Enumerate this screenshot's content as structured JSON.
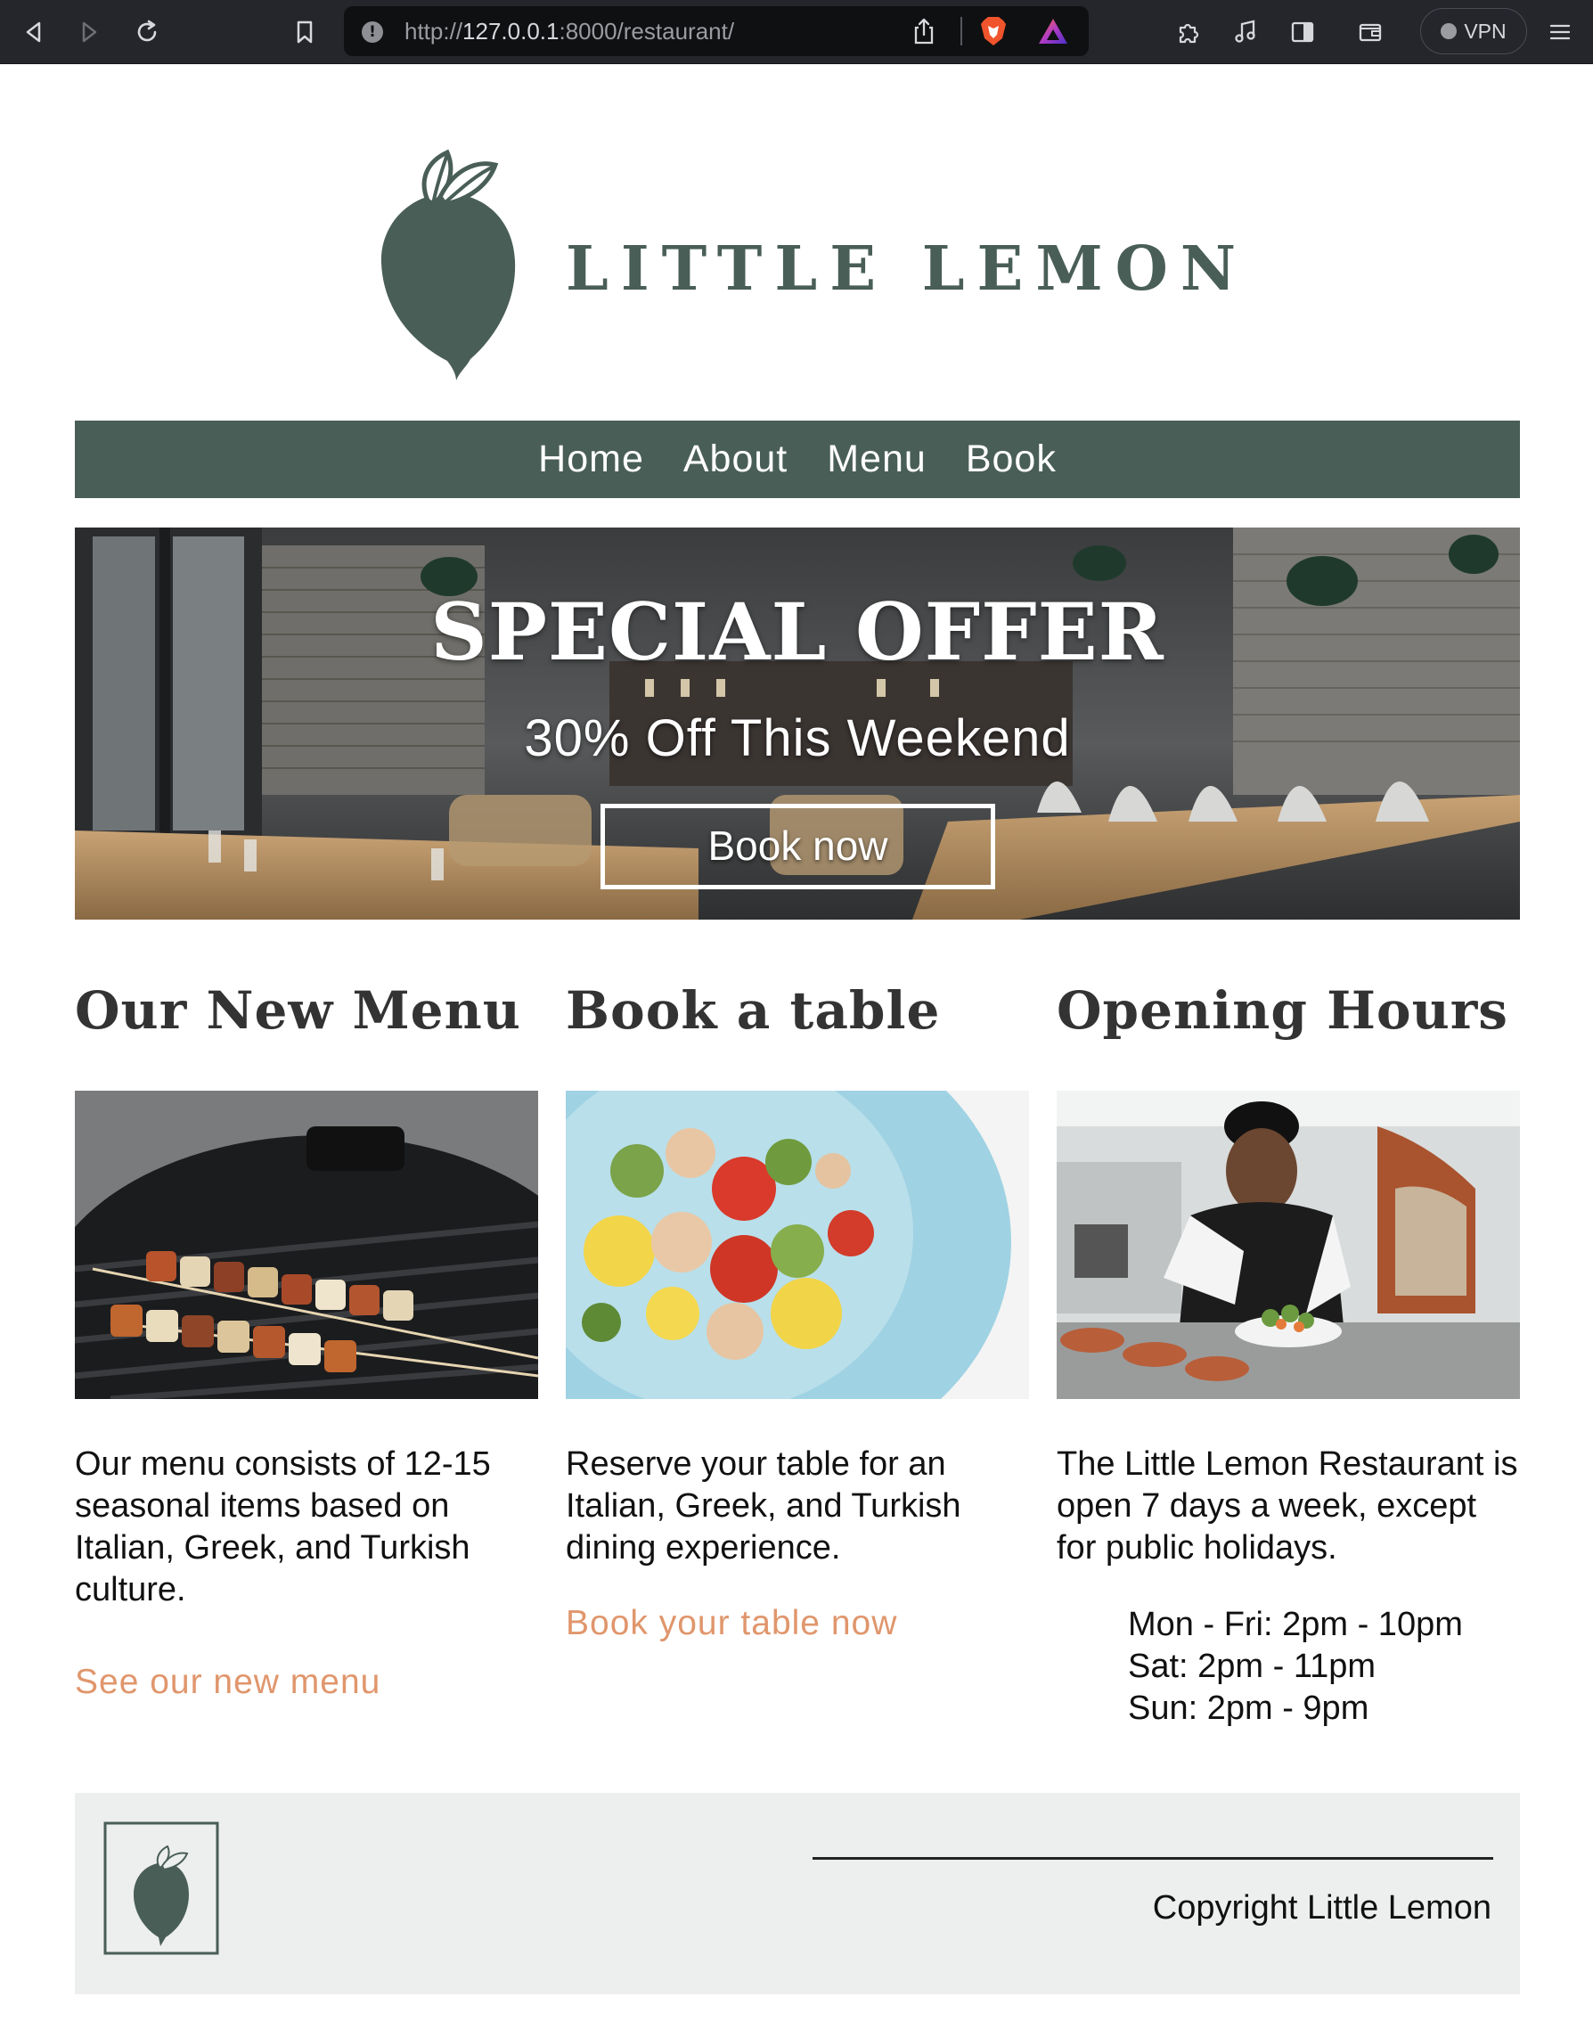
{
  "browser": {
    "url_prefix": "http://",
    "url_host": "127.0.0.1",
    "url_rest": ":8000/restaurant/",
    "vpn_label": "VPN",
    "icons": [
      "back-icon",
      "forward-icon",
      "reload-icon",
      "bookmark-icon",
      "site-info-icon",
      "share-icon",
      "brave-shields-icon",
      "brave-rewards-icon",
      "extensions-icon",
      "media-icon",
      "sidebar-icon",
      "wallet-icon",
      "menu-icon"
    ]
  },
  "site": {
    "logo_text": "LITTLE LEMON",
    "brand_color": "#495e57",
    "accent_color": "#e0966c"
  },
  "nav": {
    "items": [
      {
        "label": "Home"
      },
      {
        "label": "About"
      },
      {
        "label": "Menu"
      },
      {
        "label": "Book"
      }
    ]
  },
  "hero": {
    "title": "SPECIAL OFFER",
    "subtitle": "30% Off This Weekend",
    "button_label": "Book now"
  },
  "columns": {
    "menu": {
      "heading": "Our New Menu",
      "text": "Our menu consists of 12-15 seasonal items based on Italian, Greek, and Turkish culture.",
      "link": "See our new menu",
      "image": "grilled-skewers-photo"
    },
    "book": {
      "heading": "Book a table",
      "text": "Reserve your table for an Italian, Greek, and Turkish dining experience.",
      "link": "Book your table now",
      "image": "salad-plate-photo"
    },
    "hours": {
      "heading": "Opening Hours",
      "text": "The Little Lemon Restaurant is open 7 days a week, except for public holidays.",
      "image": "chef-cooking-photo",
      "schedule": [
        "Mon - Fri: 2pm - 10pm",
        "Sat: 2pm - 11pm",
        "Sun: 2pm - 9pm"
      ]
    }
  },
  "footer": {
    "copyright": "Copyright Little Lemon"
  }
}
